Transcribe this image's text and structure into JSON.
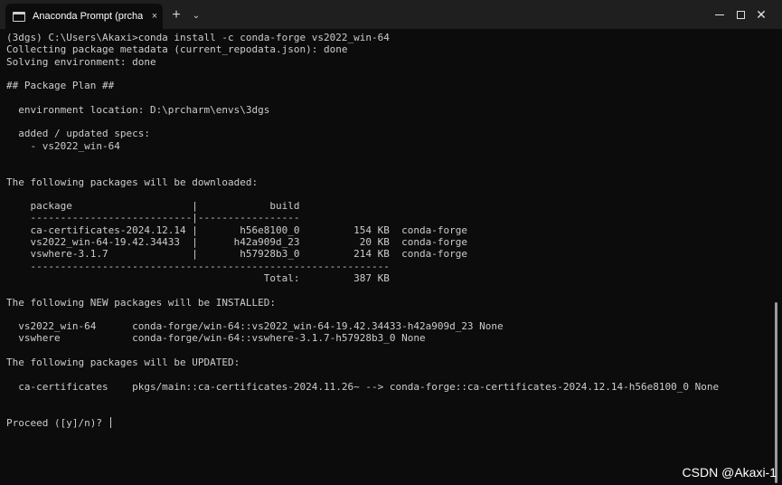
{
  "titlebar": {
    "tab_title": "Anaconda Prompt (prcharm)",
    "tab_close": "×",
    "new_tab": "+",
    "dropdown": "⌄",
    "minimize": "",
    "maximize": "",
    "close": "✕"
  },
  "terminal": {
    "lines": [
      "(3dgs) C:\\Users\\Akaxi>conda install -c conda-forge vs2022_win-64",
      "Collecting package metadata (current_repodata.json): done",
      "Solving environment: done",
      "",
      "## Package Plan ##",
      "",
      "  environment location: D:\\prcharm\\envs\\3dgs",
      "",
      "  added / updated specs:",
      "    - vs2022_win-64",
      "",
      "",
      "The following packages will be downloaded:",
      "",
      "    package                    |            build",
      "    ---------------------------|-----------------",
      "    ca-certificates-2024.12.14 |       h56e8100_0         154 KB  conda-forge",
      "    vs2022_win-64-19.42.34433  |      h42a909d_23          20 KB  conda-forge",
      "    vswhere-3.1.7              |       h57928b3_0         214 KB  conda-forge",
      "    ------------------------------------------------------------",
      "                                           Total:         387 KB",
      "",
      "The following NEW packages will be INSTALLED:",
      "",
      "  vs2022_win-64      conda-forge/win-64::vs2022_win-64-19.42.34433-h42a909d_23 None",
      "  vswhere            conda-forge/win-64::vswhere-3.1.7-h57928b3_0 None",
      "",
      "The following packages will be UPDATED:",
      "",
      "  ca-certificates    pkgs/main::ca-certificates-2024.11.26~ --> conda-forge::ca-certificates-2024.12.14-h56e8100_0 None",
      "",
      "",
      "Proceed ([y]/n)? "
    ]
  },
  "watermark": "CSDN @Akaxi-1"
}
